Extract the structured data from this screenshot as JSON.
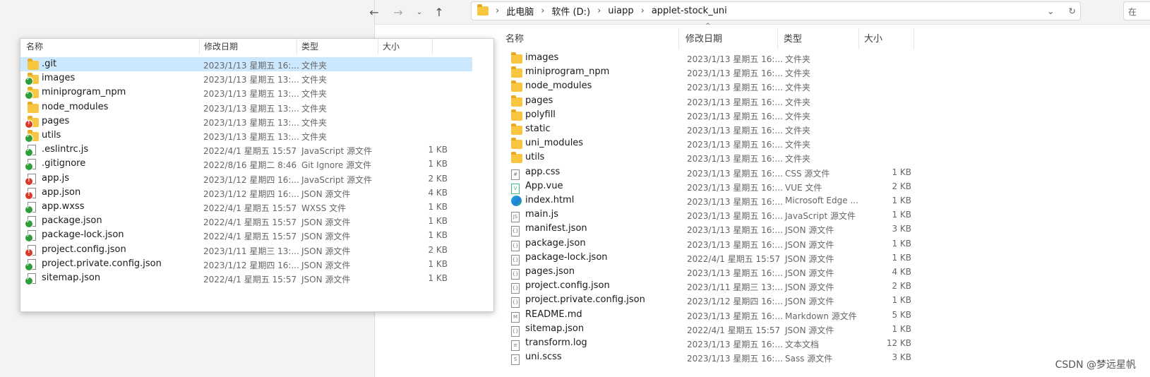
{
  "right_window": {
    "breadcrumbs": [
      "此电脑",
      "软件 (D:)",
      "uiapp",
      "applet-stock_uni"
    ],
    "search_placeholder": "在",
    "columns": {
      "name": "名称",
      "date": "修改日期",
      "type": "类型",
      "size": "大小"
    },
    "files": [
      {
        "name": "images",
        "date": "2023/1/13 星期五 16:...",
        "type": "文件夹",
        "size": "",
        "icon": "folder-icon"
      },
      {
        "name": "miniprogram_npm",
        "date": "2023/1/13 星期五 16:...",
        "type": "文件夹",
        "size": "",
        "icon": "folder-icon"
      },
      {
        "name": "node_modules",
        "date": "2023/1/13 星期五 16:...",
        "type": "文件夹",
        "size": "",
        "icon": "folder-icon"
      },
      {
        "name": "pages",
        "date": "2023/1/13 星期五 16:...",
        "type": "文件夹",
        "size": "",
        "icon": "folder-icon"
      },
      {
        "name": "polyfill",
        "date": "2023/1/13 星期五 16:...",
        "type": "文件夹",
        "size": "",
        "icon": "folder-icon"
      },
      {
        "name": "static",
        "date": "2023/1/13 星期五 16:...",
        "type": "文件夹",
        "size": "",
        "icon": "folder-icon"
      },
      {
        "name": "uni_modules",
        "date": "2023/1/13 星期五 16:...",
        "type": "文件夹",
        "size": "",
        "icon": "folder-icon"
      },
      {
        "name": "utils",
        "date": "2023/1/13 星期五 16:...",
        "type": "文件夹",
        "size": "",
        "icon": "folder-icon"
      },
      {
        "name": "app.css",
        "date": "2023/1/13 星期五 16:...",
        "type": "CSS 源文件",
        "size": "1 KB",
        "icon": "css-file-icon"
      },
      {
        "name": "App.vue",
        "date": "2023/1/13 星期五 16:...",
        "type": "VUE 文件",
        "size": "2 KB",
        "icon": "vue-file-icon"
      },
      {
        "name": "index.html",
        "date": "2023/1/13 星期五 16:...",
        "type": "Microsoft Edge ...",
        "size": "1 KB",
        "icon": "edge-icon"
      },
      {
        "name": "main.js",
        "date": "2023/1/13 星期五 16:...",
        "type": "JavaScript 源文件",
        "size": "1 KB",
        "icon": "js-file-icon"
      },
      {
        "name": "manifest.json",
        "date": "2023/1/13 星期五 16:...",
        "type": "JSON 源文件",
        "size": "3 KB",
        "icon": "json-file-icon"
      },
      {
        "name": "package.json",
        "date": "2023/1/13 星期五 16:...",
        "type": "JSON 源文件",
        "size": "1 KB",
        "icon": "json-file-icon"
      },
      {
        "name": "package-lock.json",
        "date": "2022/4/1 星期五 15:57",
        "type": "JSON 源文件",
        "size": "1 KB",
        "icon": "json-file-icon"
      },
      {
        "name": "pages.json",
        "date": "2023/1/13 星期五 16:...",
        "type": "JSON 源文件",
        "size": "4 KB",
        "icon": "json-file-icon"
      },
      {
        "name": "project.config.json",
        "date": "2023/1/11 星期三 13:...",
        "type": "JSON 源文件",
        "size": "2 KB",
        "icon": "json-file-icon"
      },
      {
        "name": "project.private.config.json",
        "date": "2023/1/12 星期四 16:...",
        "type": "JSON 源文件",
        "size": "1 KB",
        "icon": "json-file-icon"
      },
      {
        "name": "README.md",
        "date": "2023/1/13 星期五 16:...",
        "type": "Markdown 源文件",
        "size": "5 KB",
        "icon": "md-file-icon"
      },
      {
        "name": "sitemap.json",
        "date": "2022/4/1 星期五 15:57",
        "type": "JSON 源文件",
        "size": "1 KB",
        "icon": "json-file-icon"
      },
      {
        "name": "transform.log",
        "date": "2023/1/13 星期五 16:...",
        "type": "文本文档",
        "size": "12 KB",
        "icon": "text-file-icon"
      },
      {
        "name": "uni.scss",
        "date": "2023/1/13 星期五 16:...",
        "type": "Sass 源文件",
        "size": "3 KB",
        "icon": "scss-file-icon"
      }
    ]
  },
  "left_window": {
    "columns": {
      "name": "名称",
      "date": "修改日期",
      "type": "类型",
      "size": "大小"
    },
    "files": [
      {
        "name": ".git",
        "date": "2023/1/13 星期五 16:...",
        "type": "文件夹",
        "size": "",
        "kind": "folder",
        "badge": "none",
        "selected": true
      },
      {
        "name": "images",
        "date": "2023/1/13 星期五 13:...",
        "type": "文件夹",
        "size": "",
        "kind": "folder",
        "badge": "ok"
      },
      {
        "name": "miniprogram_npm",
        "date": "2023/1/13 星期五 13:...",
        "type": "文件夹",
        "size": "",
        "kind": "folder",
        "badge": "ok"
      },
      {
        "name": "node_modules",
        "date": "2023/1/13 星期五 13:...",
        "type": "文件夹",
        "size": "",
        "kind": "folder",
        "badge": "none"
      },
      {
        "name": "pages",
        "date": "2023/1/13 星期五 13:...",
        "type": "文件夹",
        "size": "",
        "kind": "folder",
        "badge": "mod"
      },
      {
        "name": "utils",
        "date": "2023/1/13 星期五 13:...",
        "type": "文件夹",
        "size": "",
        "kind": "folder",
        "badge": "ok"
      },
      {
        "name": ".eslintrc.js",
        "date": "2022/4/1 星期五 15:57",
        "type": "JavaScript 源文件",
        "size": "1 KB",
        "kind": "file",
        "badge": "ok"
      },
      {
        "name": ".gitignore",
        "date": "2022/8/16 星期二 8:46",
        "type": "Git Ignore 源文件",
        "size": "1 KB",
        "kind": "file",
        "badge": "ok"
      },
      {
        "name": "app.js",
        "date": "2023/1/12 星期四 16:...",
        "type": "JavaScript 源文件",
        "size": "2 KB",
        "kind": "file",
        "badge": "mod"
      },
      {
        "name": "app.json",
        "date": "2023/1/12 星期四 16:...",
        "type": "JSON 源文件",
        "size": "4 KB",
        "kind": "file",
        "badge": "mod"
      },
      {
        "name": "app.wxss",
        "date": "2022/4/1 星期五 15:57",
        "type": "WXSS 文件",
        "size": "1 KB",
        "kind": "file",
        "badge": "ok"
      },
      {
        "name": "package.json",
        "date": "2022/4/1 星期五 15:57",
        "type": "JSON 源文件",
        "size": "1 KB",
        "kind": "file",
        "badge": "ok"
      },
      {
        "name": "package-lock.json",
        "date": "2022/4/1 星期五 15:57",
        "type": "JSON 源文件",
        "size": "1 KB",
        "kind": "file",
        "badge": "ok"
      },
      {
        "name": "project.config.json",
        "date": "2023/1/11 星期三 13:...",
        "type": "JSON 源文件",
        "size": "2 KB",
        "kind": "file",
        "badge": "mod"
      },
      {
        "name": "project.private.config.json",
        "date": "2023/1/12 星期四 16:...",
        "type": "JSON 源文件",
        "size": "1 KB",
        "kind": "file",
        "badge": "ok"
      },
      {
        "name": "sitemap.json",
        "date": "2022/4/1 星期五 15:57",
        "type": "JSON 源文件",
        "size": "1 KB",
        "kind": "file",
        "badge": "ok"
      }
    ]
  },
  "watermark": "CSDN @梦远星帆",
  "colors": {
    "folder": "#f8c640",
    "selection": "#cce8ff",
    "badge_ok": "#2e9e3a",
    "badge_modified": "#d83a2a"
  }
}
